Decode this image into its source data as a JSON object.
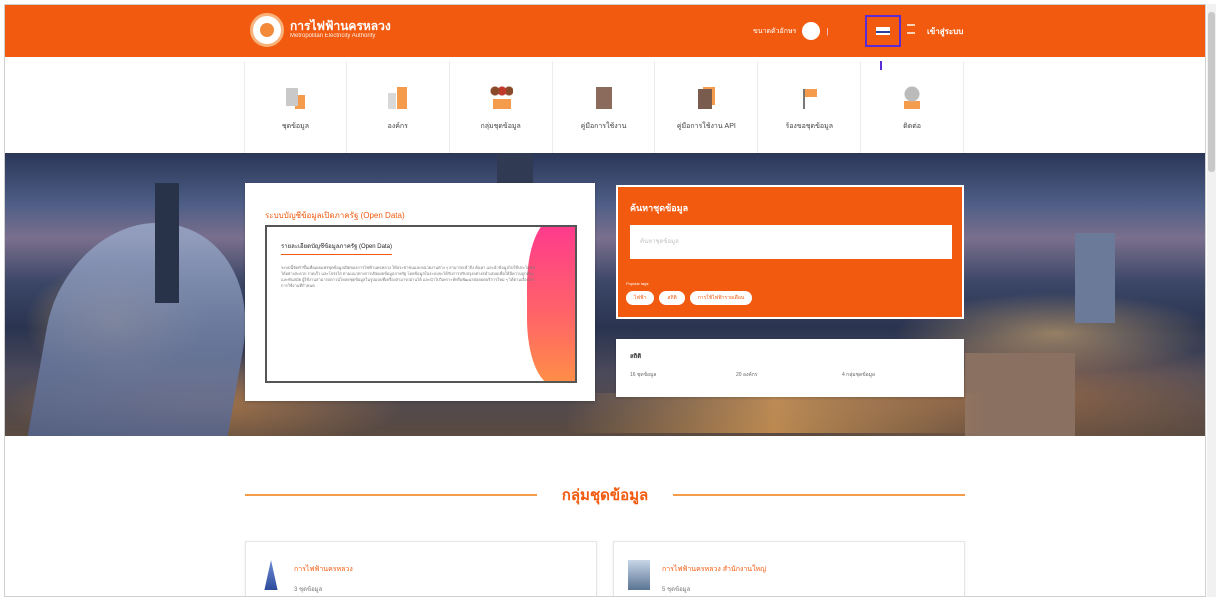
{
  "header": {
    "logo_title": "การไฟฟ้านครหลวง",
    "logo_subtitle": "Metropolitan Electricity Authority",
    "font_size_label": "ขนาดตัวอักษร",
    "separator": "|",
    "login_label": "เข้าสู่ระบบ",
    "brand_color": "#f15a0f",
    "icons": [
      "seal-logo-icon",
      "toggle-icon",
      "thai-flag-icon",
      "hamburger-icon"
    ]
  },
  "nav": {
    "items": [
      {
        "label": "ชุดข้อมูล",
        "icon": "documents-icon"
      },
      {
        "label": "องค์กร",
        "icon": "organization-icon"
      },
      {
        "label": "กลุ่มชุดข้อมูล",
        "icon": "group-icon"
      },
      {
        "label": "คู่มือการใช้งาน",
        "icon": "manual-icon"
      },
      {
        "label": "คู่มือการใช้งาน API",
        "icon": "api-icon"
      },
      {
        "label": "ร้องขอชุดข้อมูล",
        "icon": "request-flag-icon"
      },
      {
        "label": "ติดต่อ",
        "icon": "contact-icon"
      }
    ]
  },
  "info": {
    "title": "ระบบบัญชีข้อมูลเปิดภาครัฐ (Open Data)",
    "heading": "รายละเอียดบัญชีข้อมูลภาครัฐ (Open Data)",
    "body": "ระบบนี้จัดทำขึ้นเพื่อเผยแพร่ชุดข้อมูลเปิดของการไฟฟ้านครหลวง ให้ประชาชนและหน่วยงานต่าง ๆ สามารถเข้าถึง ค้นหา และนำข้อมูลไปใช้ประโยชน์ได้อย่างสะดวก รวดเร็ว และโปร่งใส ตามแนวทางการเปิดเผยข้อมูลภาครัฐ โดยข้อมูลในระบบจะได้รับการปรับปรุงอย่างสม่ำเสมอเพื่อให้มีความถูกต้องและทันสมัย ผู้ใช้งานสามารถดาวน์โหลดชุดข้อมูลในรูปแบบที่เครื่องสามารถอ่านได้ และนำไปวิเคราะห์หรือพัฒนาต่อยอดบริการใหม่ ๆ ได้ตามเงื่อนไขการใช้งานที่กำหนด"
  },
  "search": {
    "title": "ค้นหาชุดข้อมูล",
    "placeholder": "ค้นหาชุดข้อมูล",
    "popular_label": "Popular tags",
    "tags": [
      "ไฟฟ้า",
      "สถิติ",
      "การใช้ไฟฟ้ารายเดือน"
    ]
  },
  "stats": {
    "title": "สถิติ",
    "items": [
      "16 ชุดข้อมูล",
      "20 องค์กร",
      "4 กลุ่มชุดข้อมูล"
    ]
  },
  "section": {
    "title": "กลุ่มชุดข้อมูล"
  },
  "groups": [
    {
      "name": "การไฟฟ้านครหลวง",
      "count": "3 ชุดข้อมูล",
      "icon": "tower-icon"
    },
    {
      "name": "การไฟฟ้านครหลวง สำนักงานใหญ่",
      "count": "5 ชุดข้อมูล",
      "icon": "building-icon"
    }
  ]
}
